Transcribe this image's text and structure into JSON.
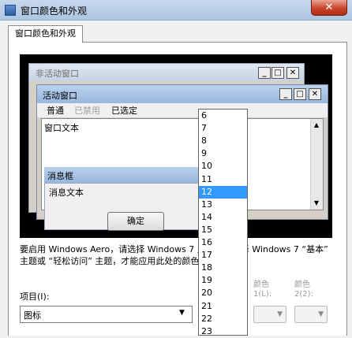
{
  "window": {
    "title": "窗口颜色和外观",
    "close_glyph": "✕"
  },
  "tab": {
    "label": "窗口颜色和外观"
  },
  "preview": {
    "inactive_title": "非活动窗口",
    "active_title": "活动窗口",
    "menu": {
      "normal": "普通",
      "disabled": "已禁用",
      "selected": "已选定"
    },
    "window_text": "窗口文本",
    "message_box_title": "消息框",
    "message_text": "消息文本",
    "ok_label": "确定",
    "caption_buttons": {
      "minimize": "_",
      "maximize": "□",
      "close": "✕"
    }
  },
  "description": "要启用 Windows Aero，请选择 Windows 7 主题。要选择 Windows 7 “基本” 主题或 “轻松访问” 主题，才能应用此处的颜色和大小。",
  "item": {
    "label": "项目(I):",
    "value": "图标",
    "arrow": "▼"
  },
  "color1": {
    "label": "颜色",
    "sub_label": "1(L):",
    "arrow": "▼"
  },
  "color2": {
    "label": "颜色",
    "sub_label": "2(2):",
    "arrow": "▼"
  },
  "size_dropdown": {
    "options": [
      "6",
      "7",
      "8",
      "9",
      "10",
      "11",
      "12",
      "13",
      "14",
      "15",
      "16",
      "17",
      "18",
      "19",
      "20",
      "21",
      "22",
      "23"
    ],
    "selected": "12"
  },
  "colors": {
    "selection": "#3399ff",
    "active_caption": "#99b7dd",
    "close_button": "#c9452c"
  }
}
